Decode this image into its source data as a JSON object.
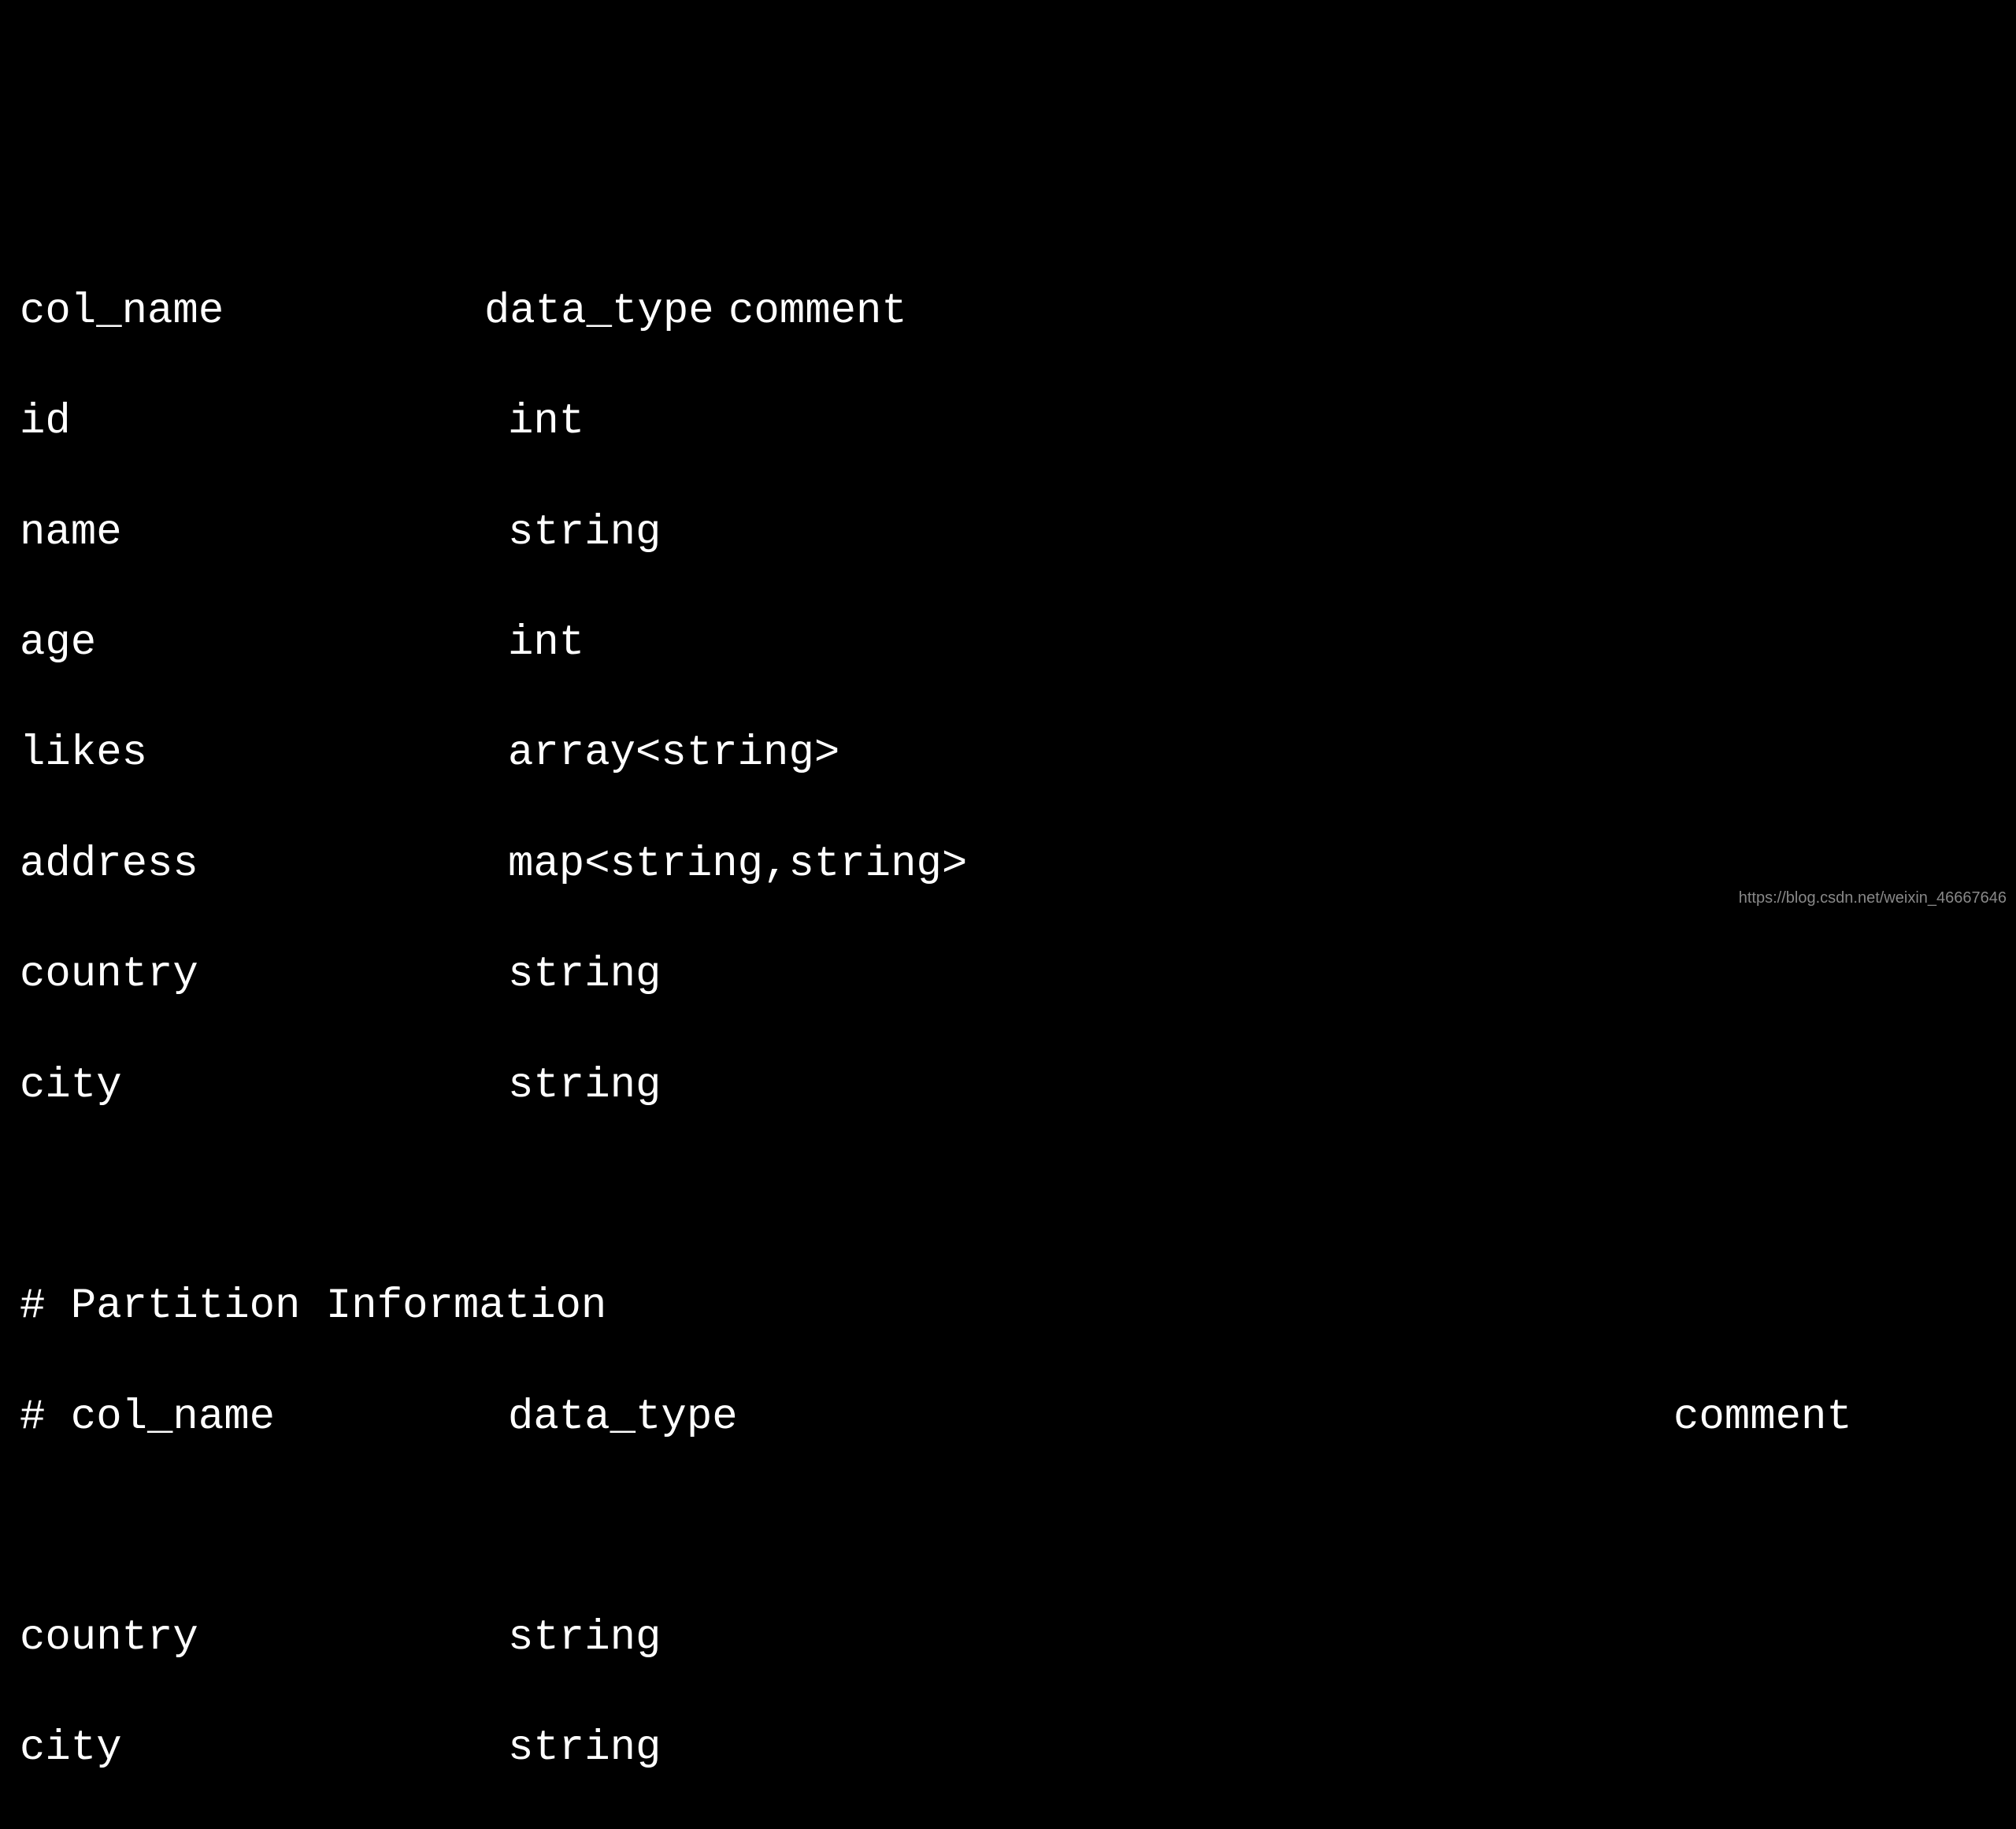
{
  "header": {
    "col_name": "col_name",
    "data_type": "data_type",
    "comment": "comment"
  },
  "columns": [
    {
      "name": "id",
      "type": "int"
    },
    {
      "name": "name",
      "type": "string"
    },
    {
      "name": "age",
      "type": "int"
    },
    {
      "name": "likes",
      "type": "array<string>"
    },
    {
      "name": "address",
      "type": "map<string,string>"
    },
    {
      "name": "country",
      "type": "string"
    },
    {
      "name": "city",
      "type": "string"
    }
  ],
  "partition_section": {
    "title": "# Partition Information",
    "header": {
      "col_name": "# col_name",
      "data_type": "data_type",
      "comment": "comment"
    },
    "columns": [
      {
        "name": "country",
        "type": "string"
      },
      {
        "name": "city",
        "type": "string"
      }
    ]
  },
  "watermark": "https://blog.csdn.net/weixin_46667646"
}
